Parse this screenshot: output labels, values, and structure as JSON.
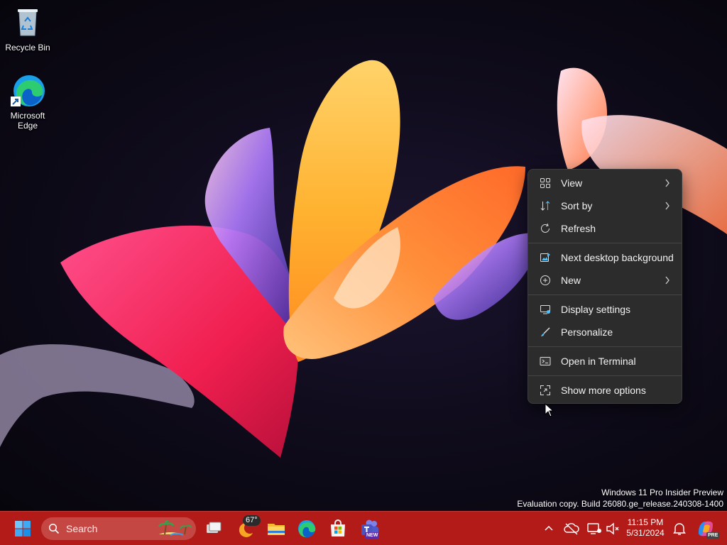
{
  "desktop": {
    "icons": [
      {
        "label": "Recycle Bin",
        "icon": "recycle-bin-icon"
      },
      {
        "label": "Microsoft Edge",
        "icon": "edge-icon"
      }
    ]
  },
  "context_menu": {
    "items": [
      {
        "label": "View",
        "icon": "view-grid-icon",
        "submenu": true
      },
      {
        "label": "Sort by",
        "icon": "sort-icon",
        "submenu": true
      },
      {
        "label": "Refresh",
        "icon": "refresh-icon",
        "submenu": false
      },
      {
        "label": "Next desktop background",
        "icon": "next-background-icon",
        "submenu": false
      },
      {
        "label": "New",
        "icon": "new-plus-icon",
        "submenu": true
      },
      {
        "label": "Display settings",
        "icon": "display-icon",
        "submenu": false
      },
      {
        "label": "Personalize",
        "icon": "brush-icon",
        "submenu": false
      },
      {
        "label": "Open in Terminal",
        "icon": "terminal-icon",
        "submenu": false
      },
      {
        "label": "Show more options",
        "icon": "more-options-icon",
        "submenu": false
      }
    ]
  },
  "watermark": {
    "line1": "Windows 11 Pro Insider Preview",
    "line2": "Evaluation copy. Build 26080.ge_release.240308-1400"
  },
  "taskbar": {
    "search_placeholder": "Search",
    "weather_temp": "67°",
    "teams_badge": "NEW",
    "time": "11:15 PM",
    "date": "5/31/2024",
    "copilot_badge": "PRE",
    "accent_color": "#b31b18"
  }
}
